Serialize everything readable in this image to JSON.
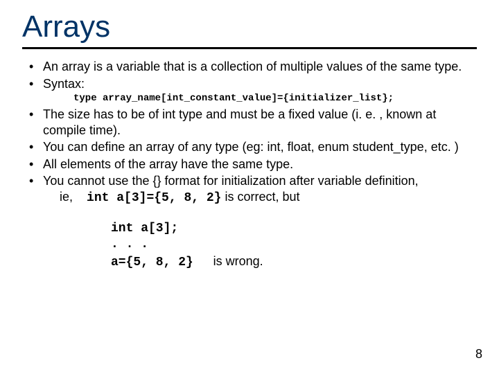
{
  "title": "Arrays",
  "bullets": {
    "b1": "An array is a variable that is a collection of multiple values of the same type.",
    "b2": "Syntax:",
    "syntax": "type array_name[int_constant_value]={initializer_list};",
    "b3": "The size has to be of int type and must be a fixed value (i. e. , known at compile time).",
    "b4": "You can define an array of any type (eg: int, float, enum student_type, etc. )",
    "b5": "All elements of the array have the same type.",
    "b6_a": "You cannot use the {} format for initialization after variable definition,",
    "b6_ie": "ie,",
    "b6_code": "int a[3]={5, 8, 2}",
    "b6_tail": " is correct, but"
  },
  "code_block": {
    "l1": "int a[3];",
    "l2": ". . .",
    "l3": "a={5, 8, 2}",
    "wrong": " is wrong."
  },
  "page_number": "8"
}
